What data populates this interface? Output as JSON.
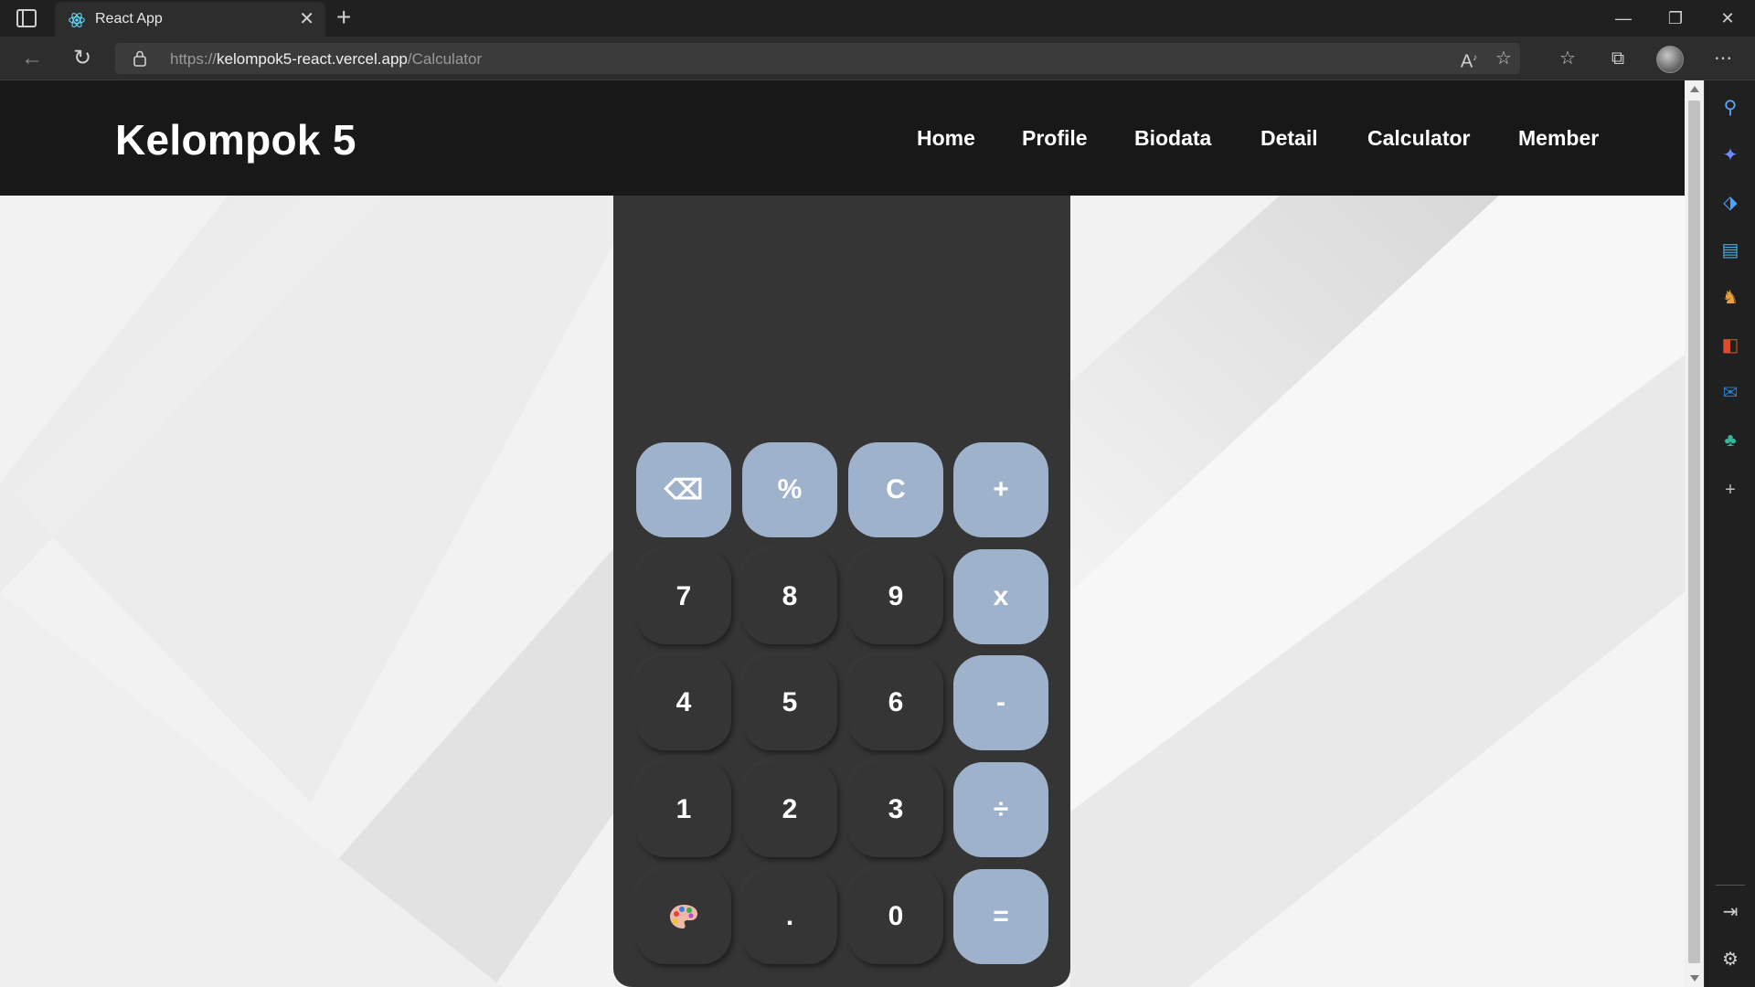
{
  "browser": {
    "tab_title": "React App",
    "url_scheme": "https://",
    "url_host": "kelompok5-react.vercel.app",
    "url_path": "/Calculator"
  },
  "site": {
    "brand": "Kelompok 5",
    "nav": [
      "Home",
      "Profile",
      "Biodata",
      "Detail",
      "Calculator",
      "Member"
    ]
  },
  "calculator": {
    "display": "",
    "keys": {
      "backspace": "⌫",
      "percent": "%",
      "clear": "C",
      "add": "+",
      "seven": "7",
      "eight": "8",
      "nine": "9",
      "multiply": "x",
      "four": "4",
      "five": "5",
      "six": "6",
      "subtract": "-",
      "one": "1",
      "two": "2",
      "three": "3",
      "divide": "÷",
      "theme": "🎨",
      "decimal": ".",
      "zero": "0",
      "equals": "="
    },
    "colors": {
      "operator": "#9fb2cc",
      "body": "#353535",
      "header": "#181818"
    }
  }
}
